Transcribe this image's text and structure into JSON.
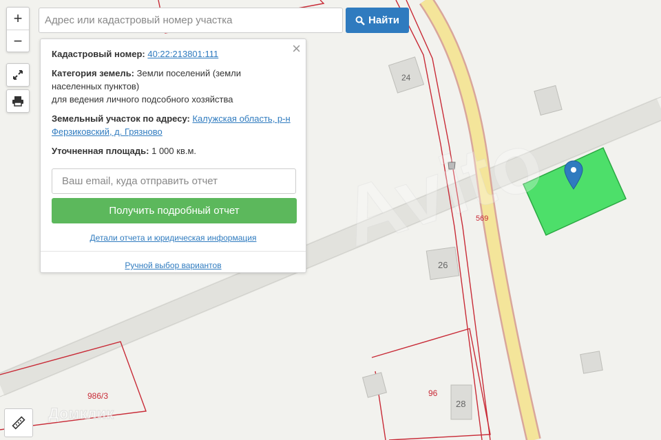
{
  "search": {
    "placeholder": "Адрес или кадастровый номер участка",
    "button_label": "Найти"
  },
  "controls": {
    "zoom_in": "+",
    "zoom_out": "−"
  },
  "popup": {
    "cadastral_label": "Кадастровый номер:",
    "cadastral_number": "40:22:213801:111",
    "category_label": "Категория земель:",
    "category_value_1": "Земли поселений (земли",
    "category_value_2": "населенных пунктов)",
    "category_value_3": "для ведения личного подсобного хозяйства",
    "address_label": "Земельный участок по адресу:",
    "address_value_1": "Калужская область, р-н",
    "address_value_2": "Ферзиковский, д. Грязново",
    "area_label": "Уточненная площадь:",
    "area_value": "1 000 кв.м.",
    "email_placeholder": "Ваш email, куда отправить отчет",
    "report_button": "Получить подробный отчет",
    "details_link": "Детали отчета и юридическая информация",
    "manual_link": "Ручной выбор вариантов",
    "close_symbol": "×"
  },
  "map_labels": {
    "house_24": "24",
    "house_26": "26",
    "house_28": "28",
    "parcel_569": "569",
    "parcel_96": "96",
    "parcel_986_3": "986/3"
  },
  "watermark": {
    "avito": "Avito",
    "domclick": "Домклик"
  },
  "colors": {
    "accent": "#2f7bbf",
    "report_button": "#5cb85c",
    "selected_parcel": "#4ddf6a",
    "boundary": "#c82a36",
    "road": "#f4e59a"
  }
}
